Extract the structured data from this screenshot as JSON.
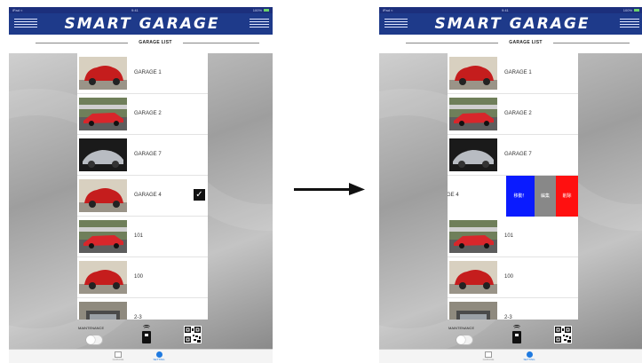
{
  "app": {
    "title": "SMART GARAGE",
    "subtitle": "GARAGE LIST",
    "status": {
      "left": "iPad ≈",
      "center": "9:41",
      "right": "100%"
    }
  },
  "colors": {
    "header": "#1e3a8a",
    "action_move": "#0a1bff",
    "action_edit": "#888888",
    "action_delete": "#ff1010",
    "tab_active": "#1f7ae0"
  },
  "left_screen": {
    "rows": [
      {
        "label": "GARAGE 1",
        "thumb": "red-beetle",
        "checked": false
      },
      {
        "label": "GARAGE 2",
        "thumb": "red-racecar-track",
        "checked": false
      },
      {
        "label": "GARAGE 7",
        "thumb": "silver-sportscar-dark",
        "checked": false
      },
      {
        "label": "GARAGE 4",
        "thumb": "red-beetle",
        "checked": true
      },
      {
        "label": "101",
        "thumb": "red-racecar-track",
        "checked": false
      },
      {
        "label": "100",
        "thumb": "red-beetle",
        "checked": false
      },
      {
        "label": "2-3",
        "thumb": "grey-car-front",
        "checked": false
      }
    ]
  },
  "right_screen": {
    "rows": [
      {
        "label": "GARAGE 1",
        "thumb": "red-beetle"
      },
      {
        "label": "GARAGE 2",
        "thumb": "red-racecar-track"
      },
      {
        "label": "GARAGE 7",
        "thumb": "silver-sportscar-dark"
      },
      {
        "label": "GARAGE 4",
        "thumb": "swiped-row",
        "visible_text": "GE 4"
      },
      {
        "label": "101",
        "thumb": "red-racecar-track"
      },
      {
        "label": "100",
        "thumb": "red-beetle"
      },
      {
        "label": "2-3",
        "thumb": "grey-car-front"
      }
    ],
    "swipe_actions": {
      "move": "移動！",
      "edit": "編集",
      "delete": "削除"
    }
  },
  "bottom": {
    "maintenance_label": "MAINTENANCE",
    "maintenance_on": false,
    "nfc_icon": "nfc-reader-icon",
    "qr_icon": "qr-code-icon"
  },
  "tabs": [
    {
      "label": "GARAGE",
      "icon": "list-icon",
      "active": false
    },
    {
      "label": "SETTING",
      "icon": "gear-icon",
      "active": true
    }
  ],
  "arrow_icon": "right-arrow-icon"
}
